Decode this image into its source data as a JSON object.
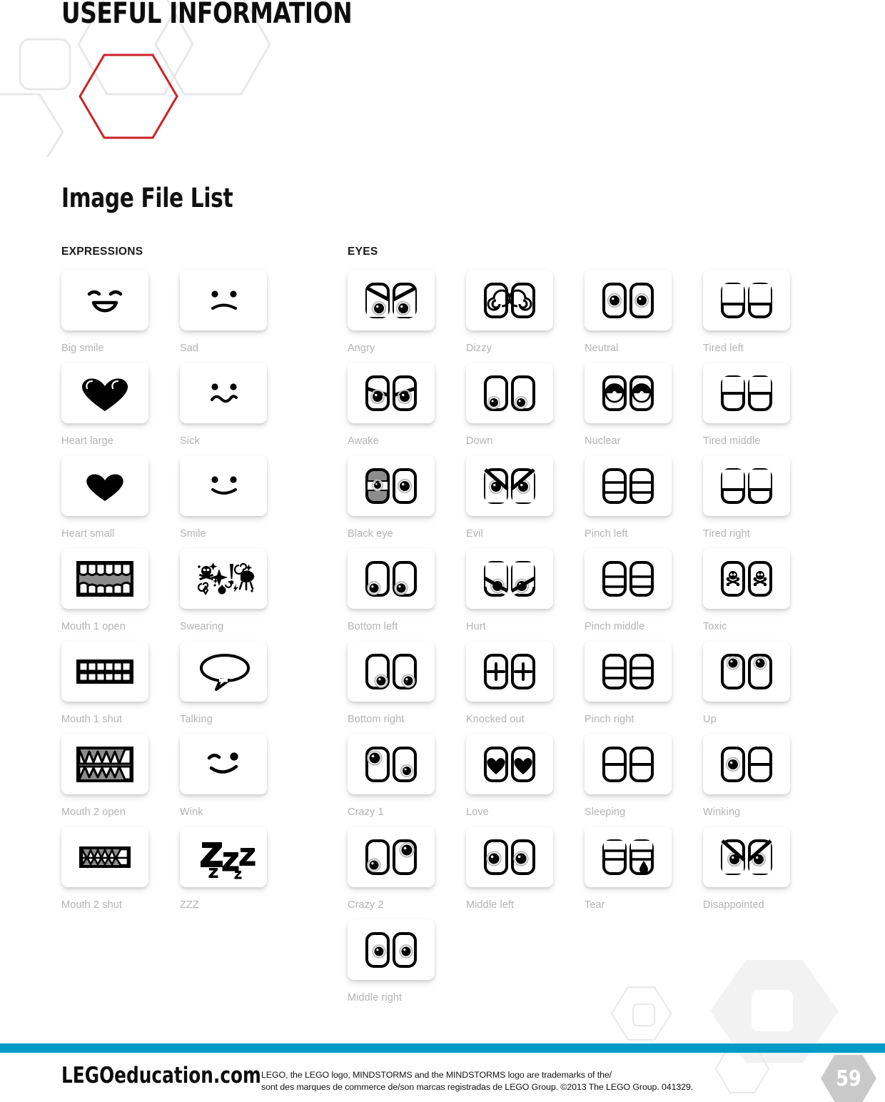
{
  "header": {
    "title": "USEFUL INFORMATION"
  },
  "section": {
    "title": "Image File List"
  },
  "columns": {
    "expressions_head": "EXPRESSIONS",
    "eyes_head": "EYES"
  },
  "colors": {
    "footer_bar": "#009ac6",
    "accent_red": "#cc2229",
    "caption_gray": "#b3b3b3",
    "deco_gray": "#e8e8e8",
    "page_badge": "#c9c9c9"
  },
  "expressions": [
    {
      "label": "Big smile",
      "icon": "big-smile-icon"
    },
    {
      "label": "Sad",
      "icon": "sad-icon"
    },
    {
      "label": "Heart large",
      "icon": "heart-large-icon"
    },
    {
      "label": "Sick",
      "icon": "sick-icon"
    },
    {
      "label": "Heart small",
      "icon": "heart-small-icon"
    },
    {
      "label": "Smile",
      "icon": "smile-icon"
    },
    {
      "label": "Mouth 1 open",
      "icon": "mouth-1-open-icon"
    },
    {
      "label": "Swearing",
      "icon": "swearing-icon"
    },
    {
      "label": "Mouth 1 shut",
      "icon": "mouth-1-shut-icon"
    },
    {
      "label": "Talking",
      "icon": "talking-icon"
    },
    {
      "label": "Mouth 2 open",
      "icon": "mouth-2-open-icon"
    },
    {
      "label": "Wink",
      "icon": "wink-icon"
    },
    {
      "label": "Mouth 2 shut",
      "icon": "mouth-2-shut-icon"
    },
    {
      "label": "ZZZ",
      "icon": "zzz-icon"
    }
  ],
  "eyes": [
    {
      "label": "Angry",
      "icon": "angry-eyes-icon"
    },
    {
      "label": "Dizzy",
      "icon": "dizzy-eyes-icon"
    },
    {
      "label": "Neutral",
      "icon": "neutral-eyes-icon"
    },
    {
      "label": "Tired left",
      "icon": "tired-left-eyes-icon"
    },
    {
      "label": "Awake",
      "icon": "awake-eyes-icon"
    },
    {
      "label": "Down",
      "icon": "down-eyes-icon"
    },
    {
      "label": "Nuclear",
      "icon": "nuclear-eyes-icon"
    },
    {
      "label": "Tired middle",
      "icon": "tired-middle-eyes-icon"
    },
    {
      "label": "Black eye",
      "icon": "black-eye-icon"
    },
    {
      "label": "Evil",
      "icon": "evil-eyes-icon"
    },
    {
      "label": "Pinch left",
      "icon": "pinch-left-eyes-icon"
    },
    {
      "label": "Tired right",
      "icon": "tired-right-eyes-icon"
    },
    {
      "label": "Bottom left",
      "icon": "bottom-left-eyes-icon"
    },
    {
      "label": "Hurt",
      "icon": "hurt-eyes-icon"
    },
    {
      "label": "Pinch middle",
      "icon": "pinch-middle-eyes-icon"
    },
    {
      "label": "Toxic",
      "icon": "toxic-eyes-icon"
    },
    {
      "label": "Bottom right",
      "icon": "bottom-right-eyes-icon"
    },
    {
      "label": "Knocked out",
      "icon": "knocked-out-eyes-icon"
    },
    {
      "label": "Pinch right",
      "icon": "pinch-right-eyes-icon"
    },
    {
      "label": "Up",
      "icon": "up-eyes-icon"
    },
    {
      "label": "Crazy 1",
      "icon": "crazy-1-eyes-icon"
    },
    {
      "label": "Love",
      "icon": "love-eyes-icon"
    },
    {
      "label": "Sleeping",
      "icon": "sleeping-eyes-icon"
    },
    {
      "label": "Winking",
      "icon": "winking-eyes-icon"
    },
    {
      "label": "Crazy 2",
      "icon": "crazy-2-eyes-icon"
    },
    {
      "label": "Middle left",
      "icon": "middle-left-eyes-icon"
    },
    {
      "label": "Tear",
      "icon": "tear-eyes-icon"
    },
    {
      "label": "Disappointed",
      "icon": "disappointed-eyes-icon"
    },
    {
      "label": "Middle right",
      "icon": "middle-right-eyes-icon"
    }
  ],
  "footer": {
    "logo": "LEGOeducation.com",
    "legal_line1": "LEGO, the LEGO logo, MINDSTORMS and the MINDSTORMS logo are trademarks of the/",
    "legal_line2": "sont des marques de commerce de/son marcas registradas de LEGO Group. ©2013 The LEGO Group. 041329.",
    "page_number": "59"
  }
}
